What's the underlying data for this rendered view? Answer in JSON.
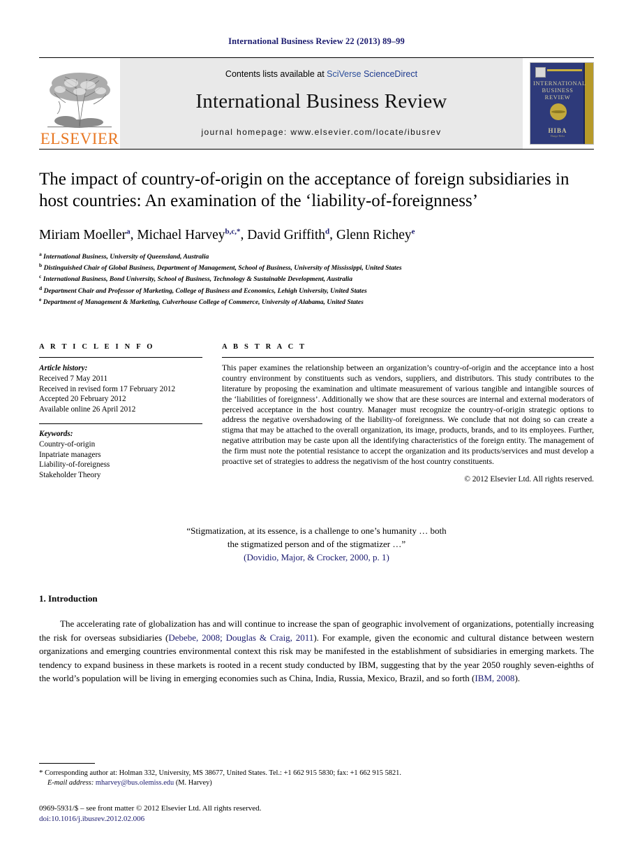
{
  "running_head": "International Business Review 22 (2013) 89–99",
  "masthead": {
    "publisher_name": "ELSEVIER",
    "contents_prefix": "Contents lists available at ",
    "contents_link_1": "SciVerse",
    "contents_link_2": " ScienceDirect",
    "journal_title": "International Business Review",
    "homepage": "journal homepage: www.elsevier.com/locate/ibusrev",
    "cover": {
      "title_line_1": "INTERNATIONAL",
      "title_line_2": "BUSINESS",
      "title_line_3": "REVIEW",
      "society": "HIBA",
      "society_sub": "Haaga-Helia"
    }
  },
  "article": {
    "title": "The impact of country-of-origin on the acceptance of foreign subsidiaries in host countries: An examination of the ‘liability-of-foreignness’",
    "authors": [
      {
        "name": "Miriam Moeller",
        "marks": "a",
        "sep": ", "
      },
      {
        "name": "Michael Harvey",
        "marks": "b,c,*",
        "sep": ", "
      },
      {
        "name": "David Griffith",
        "marks": "d",
        "sep": ", "
      },
      {
        "name": "Glenn Richey",
        "marks": "e",
        "sep": ""
      }
    ],
    "affiliations": [
      {
        "mark": "a",
        "text": "International Business, University of Queensland, Australia"
      },
      {
        "mark": "b",
        "text": "Distinguished Chair of Global Business, Department of Management, School of Business, University of Mississippi, United States"
      },
      {
        "mark": "c",
        "text": "International Business, Bond University, School of Business, Technology & Sustainable Development, Australia"
      },
      {
        "mark": "d",
        "text": "Department Chair and Professor of Marketing, College of Business and Economics, Lehigh University, United States"
      },
      {
        "mark": "e",
        "text": "Department of Management & Marketing, Culverhouse College of Commerce, University of Alabama, United States"
      }
    ]
  },
  "article_info": {
    "label": "A R T I C L E  I N F O",
    "history_title": "Article history:",
    "history": [
      "Received 7 May 2011",
      "Received in revised form 17 February 2012",
      "Accepted 20 February 2012",
      "Available online 26 April 2012"
    ],
    "keywords_title": "Keywords:",
    "keywords": [
      "Country-of-origin",
      "Inpatriate managers",
      "Liability-of-foreigness",
      "Stakeholder Theory"
    ]
  },
  "abstract": {
    "label": "A B S T R A C T",
    "text": "This paper examines the relationship between an organization’s country-of-origin and the acceptance into a host country environment by constituents such as vendors, suppliers, and distributors. This study contributes to the literature by proposing the examination and ultimate measurement of various tangible and intangible sources of the ‘liabilities of foreignness’. Additionally we show that are these sources are internal and external moderators of perceived acceptance in the host country. Manager must recognize the country-of-origin strategic options to address the negative overshadowing of the liability-of foreignness. We conclude that not doing so can create a stigma that may be attached to the overall organization, its image, products, brands, and to its employees. Further, negative attribution may be caste upon all the identifying characteristics of the foreign entity. The management of the firm must note the potential resistance to accept the organization and its products/services and must develop a proactive set of strategies to address the negativism of the host country constituents.",
    "copyright": "© 2012 Elsevier Ltd. All rights reserved."
  },
  "epigraph": {
    "line1": "“Stigmatization, at its essence, is a challenge to one’s humanity … both",
    "line2": "the stigmatized person and of the stigmatizer …”",
    "citation": "(Dovidio, Major, & Crocker, 2000",
    "citation_tail": ", p. 1)"
  },
  "body": {
    "section_number_title": "1.  Introduction",
    "para1_a": "The accelerating rate of globalization has and will continue to increase the span of geographic involvement of organizations, potentially increasing the risk for overseas subsidiaries (",
    "para1_ref1": "Debebe, 2008; Douglas & Craig, 2011",
    "para1_b": "). For example, given the economic and cultural distance between western organizations and emerging countries environmental context this risk may be manifested in the establishment of subsidiaries in emerging markets. The tendency to expand business in these markets is rooted in a recent study conducted by IBM, suggesting that by the year 2050 roughly seven-eighths of the world’s population will be living in emerging economies such as China, India, Russia, Mexico, Brazil, and so forth (",
    "para1_ref2": "IBM, 2008",
    "para1_c": ")."
  },
  "footnotes": {
    "corresponding": "Corresponding author at: Holman 332, University, MS 38677, United States. Tel.: +1 662 915 5830; fax: +1 662 915 5821.",
    "email_label": "E-mail address:",
    "email": "mharvey@bus.olemiss.edu",
    "email_owner": "(M. Harvey)",
    "issn_line": "0969-5931/$ – see front matter © 2012 Elsevier Ltd. All rights reserved.",
    "doi_label": "doi:",
    "doi": "10.1016/j.ibusrev.2012.02.006"
  },
  "colors": {
    "link_blue": "#1a1a6e",
    "elsevier_orange": "#E87722",
    "masthead_grey": "#e9e9e9",
    "cover_blue": "#2e3a7a",
    "cover_gold": "#b79a2a"
  }
}
